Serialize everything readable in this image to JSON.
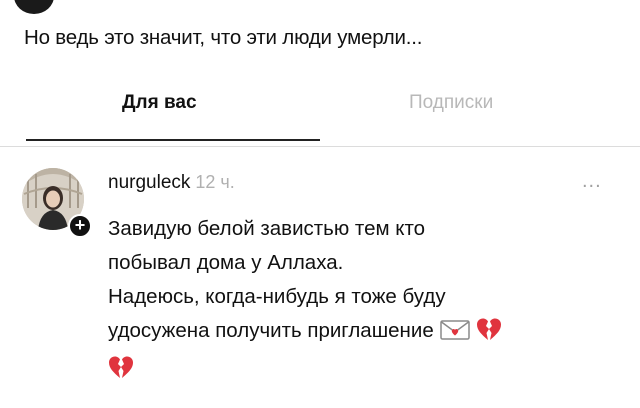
{
  "caption": "Но ведь это значит, что эти люди умерли...",
  "tabs": {
    "for_you": "Для вас",
    "subscriptions": "Подписки"
  },
  "post": {
    "username": "nurguleck",
    "timestamp": "12 ч.",
    "more": "...",
    "lines": [
      "Завидую белой завистью тем кто",
      "побывал дома у Аллаха.",
      "Надеюсь, когда-нибудь я тоже буду",
      "удосужена получить приглашение"
    ],
    "emojis": [
      "love-letter-icon",
      "broken-heart-icon",
      "broken-heart-icon"
    ]
  },
  "colors": {
    "text": "#111111",
    "inactive_tab": "#b8b8b8",
    "timestamp": "#b0b0b0",
    "broken_heart": "#e0343e",
    "divider": "#dcdcdc"
  }
}
